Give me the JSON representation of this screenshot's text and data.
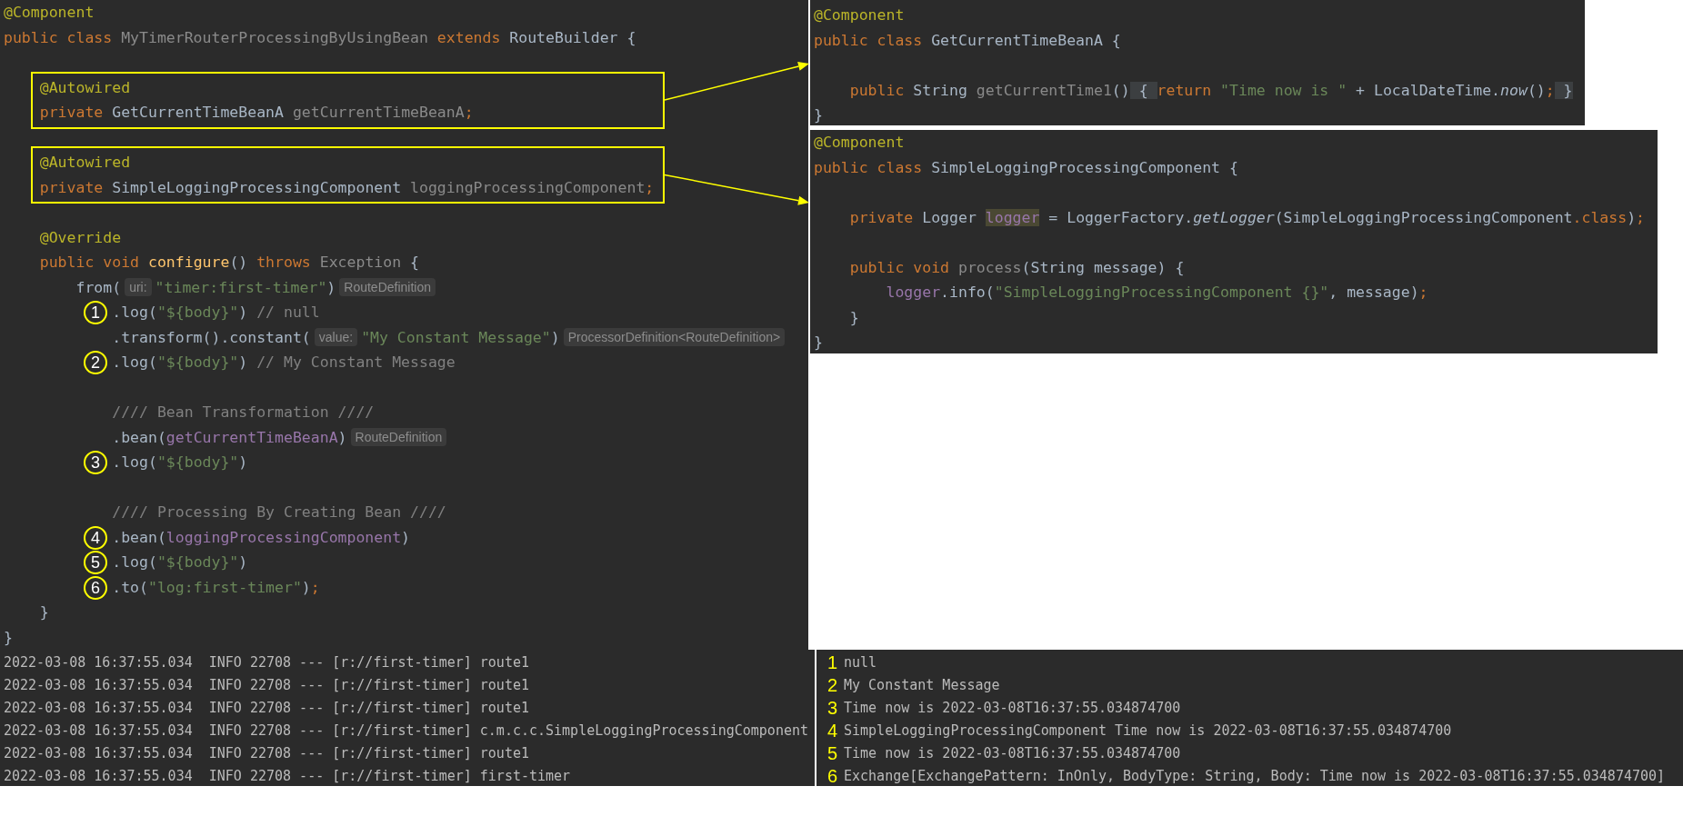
{
  "main_editor": {
    "lines": [
      {
        "kind": "code",
        "tokens": [
          {
            "kind": "annotation",
            "text": "@Component"
          }
        ]
      },
      {
        "kind": "code",
        "tokens": [
          {
            "kind": "keyword",
            "text": "public class "
          },
          {
            "kind": "unused",
            "text": "MyTimerRouterProcessingByUsingBean"
          },
          {
            "kind": "keyword",
            "text": " extends "
          },
          {
            "kind": "plain",
            "text": "RouteBuilder {"
          }
        ]
      },
      {
        "kind": "blank"
      },
      {
        "kind": "highlight_box",
        "lines": [
          {
            "kind": "code",
            "tokens": [
              {
                "kind": "annotation",
                "text": "    @Autowired"
              }
            ]
          },
          {
            "kind": "code",
            "tokens": [
              {
                "kind": "keyword",
                "text": "    private "
              },
              {
                "kind": "plain",
                "text": "GetCurrentTimeBeanA "
              },
              {
                "kind": "unused",
                "text": "getCurrentTimeBeanA"
              },
              {
                "kind": "keyword",
                "text": ";"
              }
            ]
          }
        ]
      },
      {
        "kind": "blank"
      },
      {
        "kind": "highlight_box",
        "lines": [
          {
            "kind": "code",
            "tokens": [
              {
                "kind": "annotation",
                "text": "    @Autowired"
              }
            ]
          },
          {
            "kind": "code",
            "tokens": [
              {
                "kind": "keyword",
                "text": "    private "
              },
              {
                "kind": "plain",
                "text": "SimpleLoggingProcessingComponent "
              },
              {
                "kind": "unused",
                "text": "loggingProcessingComponent"
              },
              {
                "kind": "keyword",
                "text": ";"
              }
            ]
          }
        ]
      },
      {
        "kind": "blank"
      },
      {
        "kind": "code",
        "tokens": [
          {
            "kind": "annotation",
            "text": "    @Override"
          }
        ]
      },
      {
        "kind": "code",
        "tokens": [
          {
            "kind": "keyword",
            "text": "    public void "
          },
          {
            "kind": "method",
            "text": "configure"
          },
          {
            "kind": "plain",
            "text": "() "
          },
          {
            "kind": "keyword",
            "text": "throws "
          },
          {
            "kind": "unused",
            "text": "Exception"
          },
          {
            "kind": "plain",
            "text": " {"
          }
        ]
      },
      {
        "kind": "code",
        "tokens": [
          {
            "kind": "plain",
            "text": "        from("
          },
          {
            "kind": "hint",
            "text": "uri:"
          },
          {
            "kind": "string",
            "text": "\"timer:first-timer\""
          },
          {
            "kind": "plain",
            "text": ")"
          },
          {
            "kind": "hint",
            "text": "RouteDefinition"
          }
        ]
      },
      {
        "kind": "code",
        "marker": "1",
        "tokens": [
          {
            "kind": "plain",
            "text": "            .log("
          },
          {
            "kind": "string",
            "text": "\"${body}\""
          },
          {
            "kind": "plain",
            "text": ") "
          },
          {
            "kind": "comment",
            "text": "// null"
          }
        ]
      },
      {
        "kind": "code",
        "tokens": [
          {
            "kind": "plain",
            "text": "            .transform().constant("
          },
          {
            "kind": "hint",
            "text": "value:"
          },
          {
            "kind": "string",
            "text": "\"My Constant Message\""
          },
          {
            "kind": "plain",
            "text": ")"
          },
          {
            "kind": "hint",
            "text": "ProcessorDefinition<RouteDefinition>"
          }
        ]
      },
      {
        "kind": "code",
        "marker": "2",
        "tokens": [
          {
            "kind": "plain",
            "text": "            .log("
          },
          {
            "kind": "string",
            "text": "\"${body}\""
          },
          {
            "kind": "plain",
            "text": ") "
          },
          {
            "kind": "comment",
            "text": "// My Constant Message"
          }
        ]
      },
      {
        "kind": "blank"
      },
      {
        "kind": "code",
        "tokens": [
          {
            "kind": "comment",
            "text": "            //// Bean Transformation ////"
          }
        ]
      },
      {
        "kind": "code",
        "tokens": [
          {
            "kind": "plain",
            "text": "            .bean("
          },
          {
            "kind": "field",
            "text": "getCurrentTimeBeanA"
          },
          {
            "kind": "plain",
            "text": ")"
          },
          {
            "kind": "hint",
            "text": "RouteDefinition"
          }
        ]
      },
      {
        "kind": "code",
        "marker": "3",
        "tokens": [
          {
            "kind": "plain",
            "text": "            .log("
          },
          {
            "kind": "string",
            "text": "\"${body}\""
          },
          {
            "kind": "plain",
            "text": ")"
          }
        ]
      },
      {
        "kind": "blank"
      },
      {
        "kind": "code",
        "tokens": [
          {
            "kind": "comment",
            "text": "            //// Processing By Creating Bean ////"
          }
        ]
      },
      {
        "kind": "code",
        "marker": "4",
        "tokens": [
          {
            "kind": "plain",
            "text": "            .bean("
          },
          {
            "kind": "field",
            "text": "loggingProcessingComponent"
          },
          {
            "kind": "plain",
            "text": ")"
          }
        ]
      },
      {
        "kind": "code",
        "marker": "5",
        "tokens": [
          {
            "kind": "plain",
            "text": "            .log("
          },
          {
            "kind": "string",
            "text": "\"${body}\""
          },
          {
            "kind": "plain",
            "text": ")"
          }
        ]
      },
      {
        "kind": "code",
        "marker": "6",
        "tokens": [
          {
            "kind": "plain",
            "text": "            .to("
          },
          {
            "kind": "string",
            "text": "\"log:first-timer\""
          },
          {
            "kind": "plain",
            "text": ")"
          },
          {
            "kind": "keyword",
            "text": ";"
          }
        ]
      },
      {
        "kind": "code",
        "tokens": [
          {
            "kind": "plain",
            "text": "    }"
          }
        ]
      },
      {
        "kind": "code",
        "tokens": [
          {
            "kind": "plain",
            "text": "}"
          }
        ]
      }
    ]
  },
  "bean_editor_a": {
    "lines": [
      {
        "kind": "code",
        "tokens": [
          {
            "kind": "annotation",
            "text": "@Component"
          }
        ]
      },
      {
        "kind": "code",
        "tokens": [
          {
            "kind": "keyword",
            "text": "public class "
          },
          {
            "kind": "plain",
            "text": "GetCurrentTimeBeanA {"
          }
        ]
      },
      {
        "kind": "blank"
      },
      {
        "kind": "code",
        "tokens": [
          {
            "kind": "keyword",
            "text": "    public "
          },
          {
            "kind": "plain",
            "text": "String "
          },
          {
            "kind": "unused",
            "text": "getCurrentTime1"
          },
          {
            "kind": "plain",
            "text": "()"
          },
          {
            "kind": "fold",
            "text": " { "
          },
          {
            "kind": "keyword",
            "text": "return "
          },
          {
            "kind": "string",
            "text": "\"Time now is \""
          },
          {
            "kind": "plain",
            "text": " + LocalDateTime."
          },
          {
            "kind": "static",
            "text": "now"
          },
          {
            "kind": "plain",
            "text": "()"
          },
          {
            "kind": "keyword",
            "text": ";"
          },
          {
            "kind": "fold",
            "text": " }"
          }
        ]
      },
      {
        "kind": "code",
        "tokens": [
          {
            "kind": "plain",
            "text": "}"
          }
        ]
      }
    ]
  },
  "bean_editor_b": {
    "lines": [
      {
        "kind": "code",
        "tokens": [
          {
            "kind": "annotation",
            "text": "@Component"
          }
        ]
      },
      {
        "kind": "code",
        "tokens": [
          {
            "kind": "keyword",
            "text": "public class "
          },
          {
            "kind": "plain",
            "text": "SimpleLoggingProcessingComponent {"
          }
        ]
      },
      {
        "kind": "blank"
      },
      {
        "kind": "code",
        "tokens": [
          {
            "kind": "keyword",
            "text": "    private "
          },
          {
            "kind": "plain",
            "text": "Logger "
          },
          {
            "kind": "highlight",
            "text": "logger"
          },
          {
            "kind": "plain",
            "text": " = LoggerFactory."
          },
          {
            "kind": "static",
            "text": "getLogger"
          },
          {
            "kind": "plain",
            "text": "(SimpleLoggingProcessingComponent"
          },
          {
            "kind": "keyword",
            "text": ".class"
          },
          {
            "kind": "plain",
            "text": ")"
          },
          {
            "kind": "keyword",
            "text": ";"
          }
        ]
      },
      {
        "kind": "blank"
      },
      {
        "kind": "code",
        "tokens": [
          {
            "kind": "keyword",
            "text": "    public void "
          },
          {
            "kind": "unused",
            "text": "process"
          },
          {
            "kind": "plain",
            "text": "(String message) {"
          }
        ]
      },
      {
        "kind": "code",
        "tokens": [
          {
            "kind": "field",
            "text": "        logger"
          },
          {
            "kind": "plain",
            "text": ".info("
          },
          {
            "kind": "string",
            "text": "\"SimpleLoggingProcessingComponent {}\""
          },
          {
            "kind": "plain",
            "text": ", message)"
          },
          {
            "kind": "keyword",
            "text": ";"
          }
        ]
      },
      {
        "kind": "code",
        "tokens": [
          {
            "kind": "plain",
            "text": "    }"
          }
        ]
      },
      {
        "kind": "code",
        "tokens": [
          {
            "kind": "plain",
            "text": "}"
          }
        ]
      }
    ]
  },
  "console_left": {
    "rows": [
      {
        "text": "2022-03-08 16:37:55.034  INFO 22708 --- [r://first-timer] route1"
      },
      {
        "text": "2022-03-08 16:37:55.034  INFO 22708 --- [r://first-timer] route1"
      },
      {
        "text": "2022-03-08 16:37:55.034  INFO 22708 --- [r://first-timer] route1"
      },
      {
        "text": "2022-03-08 16:37:55.034  INFO 22708 --- [r://first-timer] c.m.c.c.SimpleLoggingProcessingComponent"
      },
      {
        "text": "2022-03-08 16:37:55.034  INFO 22708 --- [r://first-timer] route1"
      },
      {
        "text": "2022-03-08 16:37:55.034  INFO 22708 --- [r://first-timer] first-timer"
      }
    ]
  },
  "console_right": {
    "rows": [
      {
        "marker": "1",
        "text": "null"
      },
      {
        "marker": "2",
        "text": "My Constant Message"
      },
      {
        "marker": "3",
        "text": "Time now is 2022-03-08T16:37:55.034874700"
      },
      {
        "marker": "4",
        "text": "SimpleLoggingProcessingComponent Time now is 2022-03-08T16:37:55.034874700"
      },
      {
        "marker": "5",
        "text": "Time now is 2022-03-08T16:37:55.034874700"
      },
      {
        "marker": "6",
        "text": "Exchange[ExchangePattern: InOnly, BodyType: String, Body: Time now is 2022-03-08T16:37:55.034874700]"
      }
    ]
  }
}
